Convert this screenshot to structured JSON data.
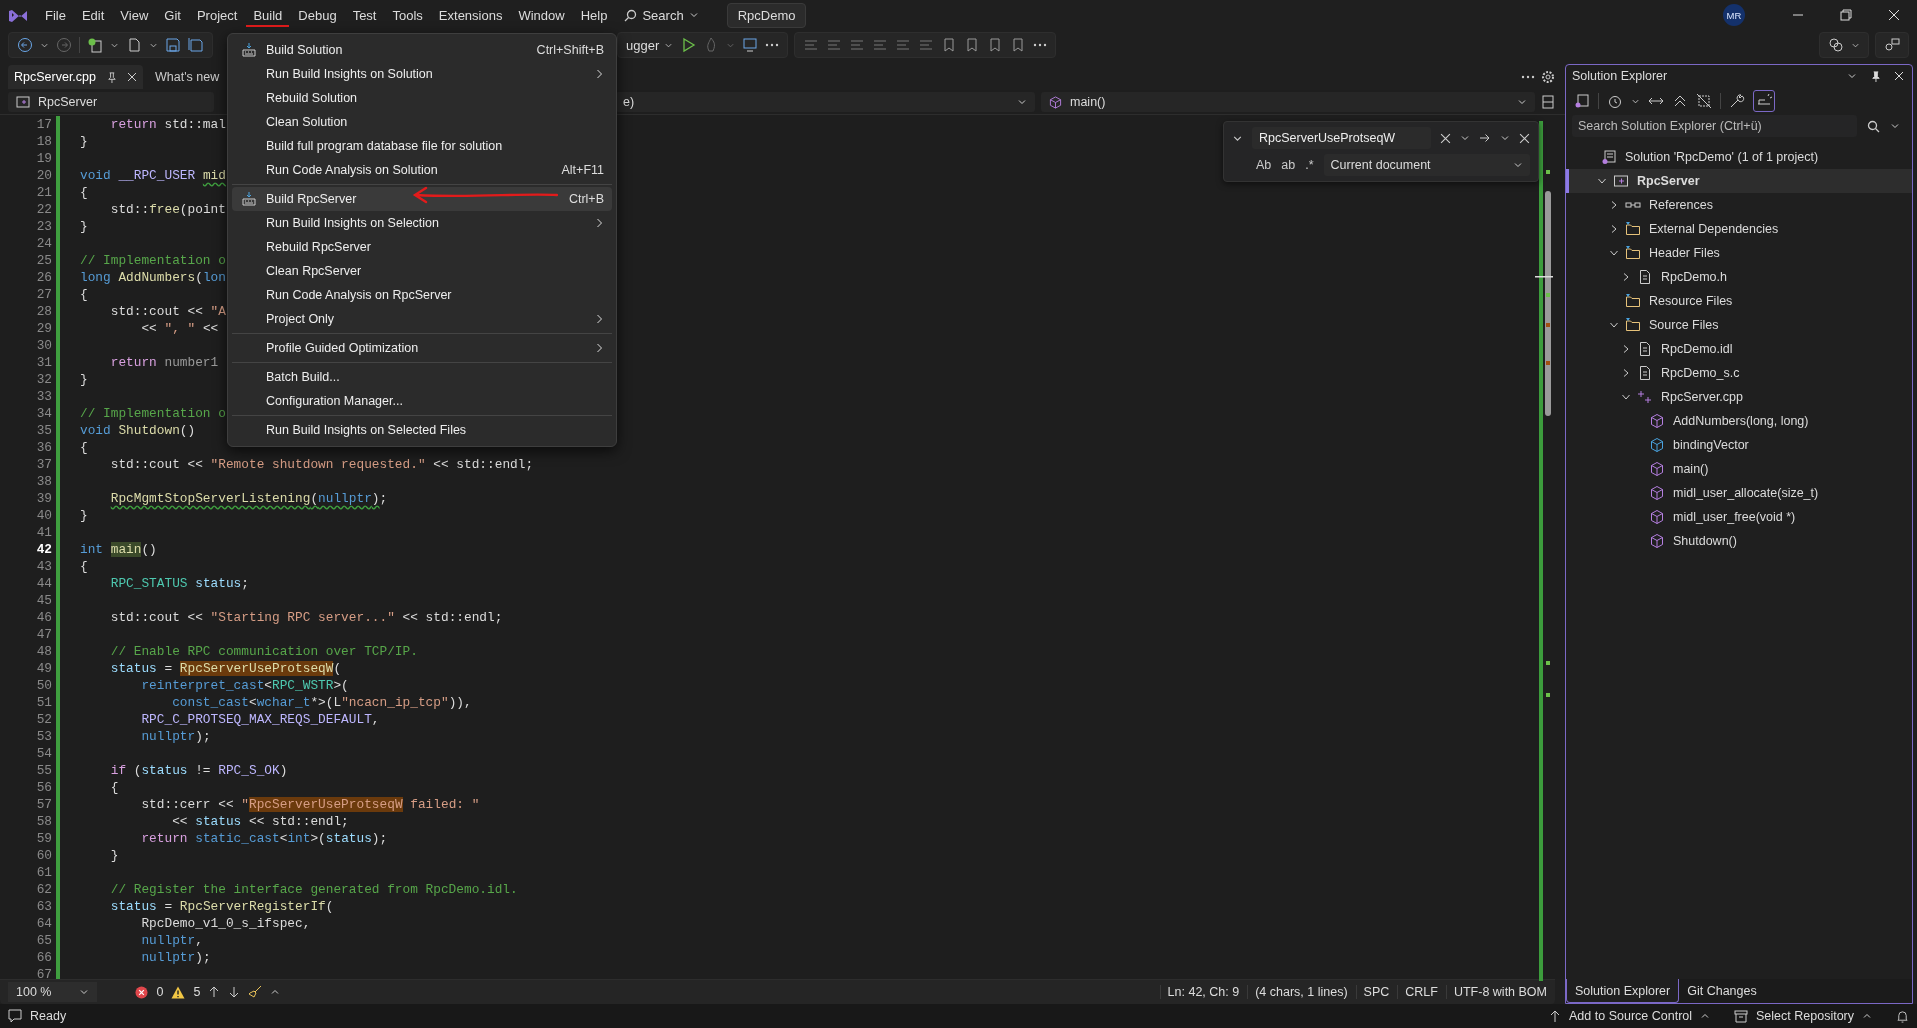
{
  "menubar": {
    "items": [
      {
        "label": "File",
        "selected": false
      },
      {
        "label": "Edit",
        "selected": false
      },
      {
        "label": "View",
        "selected": false
      },
      {
        "label": "Git",
        "selected": false
      },
      {
        "label": "Project",
        "selected": false
      },
      {
        "label": "Build",
        "selected": true
      },
      {
        "label": "Debug",
        "selected": false
      },
      {
        "label": "Test",
        "selected": false
      },
      {
        "label": "Tools",
        "selected": false
      },
      {
        "label": "Extensions",
        "selected": false
      },
      {
        "label": "Window",
        "selected": false
      },
      {
        "label": "Help",
        "selected": false
      }
    ],
    "search": "Search",
    "solution_name": "RpcDemo",
    "avatar": "MR"
  },
  "toolbar": {
    "start_text": "ugger"
  },
  "build_menu": {
    "sections": [
      {
        "items": [
          {
            "label": "Build Solution",
            "shortcut": "Ctrl+Shift+B",
            "has_icon": true,
            "submenu": false,
            "selected": false
          },
          {
            "label": "Run Build Insights on Solution",
            "has_icon": false,
            "submenu": true,
            "selected": false
          },
          {
            "label": "Rebuild Solution",
            "has_icon": false,
            "submenu": false,
            "selected": false
          },
          {
            "label": "Clean Solution",
            "has_icon": false,
            "submenu": false,
            "selected": false
          },
          {
            "label": "Build full program database file for solution",
            "has_icon": false,
            "submenu": false,
            "selected": false
          },
          {
            "label": "Run Code Analysis on Solution",
            "shortcut": "Alt+F11",
            "has_icon": false,
            "submenu": false,
            "selected": false
          }
        ]
      },
      {
        "items": [
          {
            "label": "Build RpcServer",
            "shortcut": "Ctrl+B",
            "has_icon": true,
            "submenu": false,
            "selected": true
          },
          {
            "label": "Run Build Insights on Selection",
            "has_icon": false,
            "submenu": true,
            "selected": false
          },
          {
            "label": "Rebuild RpcServer",
            "has_icon": false,
            "submenu": false,
            "selected": false
          },
          {
            "label": "Clean RpcServer",
            "has_icon": false,
            "submenu": false,
            "selected": false
          },
          {
            "label": "Run Code Analysis on RpcServer",
            "has_icon": false,
            "submenu": false,
            "selected": false
          },
          {
            "label": "Project Only",
            "has_icon": false,
            "submenu": true,
            "selected": false
          }
        ]
      },
      {
        "items": [
          {
            "label": "Profile Guided Optimization",
            "has_icon": false,
            "submenu": true,
            "selected": false
          }
        ]
      },
      {
        "items": [
          {
            "label": "Batch Build...",
            "has_icon": false,
            "submenu": false,
            "selected": false
          },
          {
            "label": "Configuration Manager...",
            "has_icon": false,
            "submenu": false,
            "selected": false
          }
        ]
      },
      {
        "items": [
          {
            "label": "Run Build Insights on Selected Files",
            "has_icon": false,
            "submenu": false,
            "selected": false
          }
        ]
      }
    ]
  },
  "editor": {
    "tabs": [
      {
        "label": "RpcServer.cpp",
        "selected": true
      },
      {
        "label": "What's new",
        "selected": false
      }
    ],
    "nav": {
      "project": "RpcServer",
      "scope": "e)",
      "member": "main()"
    },
    "find": {
      "value": "RpcServerUseProtseqW",
      "options": [
        "Ab",
        "ab",
        ".*"
      ],
      "scope": "Current document"
    },
    "lines": [
      {
        "n": "17",
        "current": false,
        "tokens": [
          {
            "text": "    return",
            "kind": "ctrl"
          },
          {
            "text": " std::mal",
            "kind": "plain"
          }
        ]
      },
      {
        "n": "18",
        "current": false,
        "tokens": [
          {
            "text": "}",
            "kind": "plain"
          }
        ]
      },
      {
        "n": "19",
        "current": false
      },
      {
        "n": "20",
        "current": false,
        "tokens": [
          {
            "text": "void",
            "kind": "kw"
          },
          {
            "text": " __RPC_USER ",
            "kind": "macro"
          },
          {
            "text": "mid",
            "kind": "fn_squiggle"
          }
        ]
      },
      {
        "n": "21",
        "current": false,
        "tokens": [
          {
            "text": "{",
            "kind": "plain"
          }
        ]
      },
      {
        "n": "22",
        "current": false,
        "tokens": [
          {
            "text": "    std::",
            "kind": "plain"
          },
          {
            "text": "free",
            "kind": "fn"
          },
          {
            "text": "(point",
            "kind": "plain"
          }
        ]
      },
      {
        "n": "23",
        "current": false,
        "tokens": [
          {
            "text": "}",
            "kind": "plain"
          }
        ]
      },
      {
        "n": "24",
        "current": false
      },
      {
        "n": "25",
        "current": false,
        "tokens": [
          {
            "text": "// Implementation o",
            "kind": "com"
          }
        ]
      },
      {
        "n": "26",
        "current": false,
        "tokens": [
          {
            "text": "long ",
            "kind": "kw"
          },
          {
            "text": "AddNumbers",
            "kind": "fn"
          },
          {
            "text": "(",
            "kind": "plain"
          },
          {
            "text": "lon",
            "kind": "kw"
          }
        ]
      },
      {
        "n": "27",
        "current": false,
        "tokens": [
          {
            "text": "{",
            "kind": "plain"
          }
        ]
      },
      {
        "n": "28",
        "current": false,
        "tokens": [
          {
            "text": "    std::cout << ",
            "kind": "plain"
          },
          {
            "text": "\"A",
            "kind": "str"
          }
        ]
      },
      {
        "n": "29",
        "current": false,
        "tokens": [
          {
            "text": "        << ",
            "kind": "plain"
          },
          {
            "text": "\", \"",
            "kind": "str"
          },
          {
            "text": " <<",
            "kind": "plain"
          }
        ]
      },
      {
        "n": "30",
        "current": false
      },
      {
        "n": "31",
        "current": false,
        "tokens": [
          {
            "text": "    return",
            "kind": "ctrl"
          },
          {
            "text": " number1",
            "kind": "param"
          }
        ]
      },
      {
        "n": "32",
        "current": false,
        "tokens": [
          {
            "text": "}",
            "kind": "plain"
          }
        ]
      },
      {
        "n": "33",
        "current": false
      },
      {
        "n": "34",
        "current": false,
        "tokens": [
          {
            "text": "// Implementation o",
            "kind": "com"
          }
        ]
      },
      {
        "n": "35",
        "current": false,
        "tokens": [
          {
            "text": "void ",
            "kind": "kw"
          },
          {
            "text": "Shutdown",
            "kind": "fn"
          },
          {
            "text": "()",
            "kind": "plain"
          }
        ]
      },
      {
        "n": "36",
        "current": false,
        "tokens": [
          {
            "text": "{",
            "kind": "plain"
          }
        ]
      },
      {
        "n": "37",
        "current": false,
        "tokens": [
          {
            "text": "    std::cout << ",
            "kind": "plain"
          },
          {
            "text": "\"Remote shutdown requested.\"",
            "kind": "str"
          },
          {
            "text": " << std::endl;",
            "kind": "plain"
          }
        ]
      },
      {
        "n": "38",
        "current": false
      },
      {
        "n": "39",
        "current": false,
        "tokens": [
          {
            "text": "    RpcMgmtStopServerListening",
            "kind": "fn_squiggle"
          },
          {
            "text": "(",
            "kind": "plain_squiggle"
          },
          {
            "text": "nullptr",
            "kind": "kw_squiggle"
          },
          {
            "text": ")",
            "kind": "plain_squiggle"
          },
          {
            "text": ";",
            "kind": "plain"
          }
        ]
      },
      {
        "n": "40",
        "current": false,
        "tokens": [
          {
            "text": "}",
            "kind": "plain"
          }
        ]
      },
      {
        "n": "41",
        "current": false
      },
      {
        "n": "42",
        "current": true,
        "tokens": [
          {
            "text": "int ",
            "kind": "kw"
          },
          {
            "text": "main",
            "kind": "fn_reference"
          },
          {
            "text": "()",
            "kind": "plain"
          }
        ]
      },
      {
        "n": "43",
        "current": false,
        "tokens": [
          {
            "text": "{",
            "kind": "plain"
          }
        ]
      },
      {
        "n": "44",
        "current": false,
        "tokens": [
          {
            "text": "    RPC_STATUS ",
            "kind": "type"
          },
          {
            "text": "status",
            "kind": "var"
          },
          {
            "text": ";",
            "kind": "plain"
          }
        ]
      },
      {
        "n": "45",
        "current": false
      },
      {
        "n": "46",
        "current": false,
        "tokens": [
          {
            "text": "    std::cout << ",
            "kind": "plain"
          },
          {
            "text": "\"Starting RPC server...\"",
            "kind": "str"
          },
          {
            "text": " << std::endl;",
            "kind": "plain"
          }
        ]
      },
      {
        "n": "47",
        "current": false
      },
      {
        "n": "48",
        "current": false,
        "tokens": [
          {
            "text": "    // Enable RPC communication over TCP/IP.",
            "kind": "com"
          }
        ]
      },
      {
        "n": "49",
        "current": false,
        "tokens": [
          {
            "text": "    status",
            "kind": "var"
          },
          {
            "text": " = ",
            "kind": "plain"
          },
          {
            "text": "RpcServerUseProtseqW",
            "kind": "fn_match"
          },
          {
            "text": "(",
            "kind": "plain"
          }
        ]
      },
      {
        "n": "50",
        "current": false,
        "tokens": [
          {
            "text": "        reinterpret_cast",
            "kind": "kw"
          },
          {
            "text": "<",
            "kind": "plain"
          },
          {
            "text": "RPC_WSTR",
            "kind": "type"
          },
          {
            "text": ">(",
            "kind": "plain"
          }
        ]
      },
      {
        "n": "51",
        "current": false,
        "tokens": [
          {
            "text": "            const_cast",
            "kind": "kw"
          },
          {
            "text": "<",
            "kind": "plain"
          },
          {
            "text": "wchar_t",
            "kind": "kw"
          },
          {
            "text": "*>(L",
            "kind": "plain"
          },
          {
            "text": "\"ncacn_ip_tcp\"",
            "kind": "str"
          },
          {
            "text": ")),",
            "kind": "plain"
          }
        ]
      },
      {
        "n": "52",
        "current": false,
        "tokens": [
          {
            "text": "        RPC_C_PROTSEQ_MAX_REQS_DEFAULT",
            "kind": "macro"
          },
          {
            "text": ",",
            "kind": "plain"
          }
        ]
      },
      {
        "n": "53",
        "current": false,
        "tokens": [
          {
            "text": "        nullptr",
            "kind": "kw"
          },
          {
            "text": ");",
            "kind": "plain"
          }
        ]
      },
      {
        "n": "54",
        "current": false
      },
      {
        "n": "55",
        "current": false,
        "tokens": [
          {
            "text": "    if",
            "kind": "ctrl"
          },
          {
            "text": " (",
            "kind": "plain"
          },
          {
            "text": "status",
            "kind": "var"
          },
          {
            "text": " != ",
            "kind": "plain"
          },
          {
            "text": "RPC_S_OK",
            "kind": "macro"
          },
          {
            "text": ")",
            "kind": "plain"
          }
        ]
      },
      {
        "n": "56",
        "current": false,
        "tokens": [
          {
            "text": "    {",
            "kind": "plain"
          }
        ]
      },
      {
        "n": "57",
        "current": false,
        "tokens": [
          {
            "text": "        std::cerr << ",
            "kind": "plain"
          },
          {
            "text": "\"",
            "kind": "str"
          },
          {
            "text": "RpcServerUseProtseqW",
            "kind": "str_match"
          },
          {
            "text": " failed: \"",
            "kind": "str"
          }
        ]
      },
      {
        "n": "58",
        "current": false,
        "tokens": [
          {
            "text": "            << ",
            "kind": "plain"
          },
          {
            "text": "status",
            "kind": "var"
          },
          {
            "text": " << std::endl;",
            "kind": "plain"
          }
        ]
      },
      {
        "n": "59",
        "current": false,
        "tokens": [
          {
            "text": "        return ",
            "kind": "ctrl"
          },
          {
            "text": "static_cast",
            "kind": "kw"
          },
          {
            "text": "<",
            "kind": "plain"
          },
          {
            "text": "int",
            "kind": "kw"
          },
          {
            "text": ">(",
            "kind": "plain"
          },
          {
            "text": "status",
            "kind": "var"
          },
          {
            "text": ");",
            "kind": "plain"
          }
        ]
      },
      {
        "n": "60",
        "current": false,
        "tokens": [
          {
            "text": "    }",
            "kind": "plain"
          }
        ]
      },
      {
        "n": "61",
        "current": false
      },
      {
        "n": "62",
        "current": false,
        "tokens": [
          {
            "text": "    // Register the interface generated from RpcDemo.idl.",
            "kind": "com"
          }
        ]
      },
      {
        "n": "63",
        "current": false,
        "tokens": [
          {
            "text": "    status",
            "kind": "var"
          },
          {
            "text": " = ",
            "kind": "plain"
          },
          {
            "text": "RpcServerRegisterIf",
            "kind": "fn"
          },
          {
            "text": "(",
            "kind": "plain"
          }
        ]
      },
      {
        "n": "64",
        "current": false,
        "tokens": [
          {
            "text": "        RpcDemo_v1_0_s_ifspec,",
            "kind": "plain"
          }
        ]
      },
      {
        "n": "65",
        "current": false,
        "tokens": [
          {
            "text": "        nullptr",
            "kind": "kw"
          },
          {
            "text": ",",
            "kind": "plain"
          }
        ]
      },
      {
        "n": "66",
        "current": false,
        "tokens": [
          {
            "text": "        nullptr",
            "kind": "kw"
          },
          {
            "text": ");",
            "kind": "plain"
          }
        ]
      },
      {
        "n": "67",
        "current": false
      }
    ],
    "status": {
      "zoom": "100 %",
      "errors": "0",
      "warnings": "5",
      "position": "Ln: 42, Ch: 9",
      "selection": "(4 chars, 1 lines)",
      "indent": "SPC",
      "line_ending": "CRLF",
      "encoding": "UTF-8 with BOM"
    }
  },
  "solution_explorer": {
    "title": "Solution Explorer",
    "search": {
      "placeholder": "Search Solution Explorer (Ctrl+ü)"
    },
    "tree": [
      {
        "label": "Solution 'RpcDemo' (1 of 1 project)",
        "kind": "solution",
        "selected": false,
        "children": [
          {
            "label": "RpcServer",
            "kind": "project",
            "expanded": true,
            "selected": true,
            "children": [
              {
                "label": "References",
                "kind": "references",
                "expanded": false,
                "selected": false
              },
              {
                "label": "External Dependencies",
                "kind": "deps",
                "expanded": false,
                "selected": false
              },
              {
                "label": "Header Files",
                "kind": "folder",
                "expanded": true,
                "selected": false,
                "children": [
                  {
                    "label": "RpcDemo.h",
                    "kind": "header",
                    "expanded": false,
                    "selected": false
                  }
                ]
              },
              {
                "label": "Resource Files",
                "kind": "folder",
                "selected": false
              },
              {
                "label": "Source Files",
                "kind": "folder",
                "expanded": true,
                "selected": false,
                "children": [
                  {
                    "label": "RpcDemo.idl",
                    "kind": "file",
                    "expanded": false,
                    "selected": false
                  },
                  {
                    "label": "RpcDemo_s.c",
                    "kind": "csource",
                    "expanded": false,
                    "selected": false
                  },
                  {
                    "label": "RpcServer.cpp",
                    "kind": "cpp",
                    "expanded": true,
                    "selected": false,
                    "children": [
                      {
                        "label": "AddNumbers(long, long)",
                        "kind": "method",
                        "selected": false
                      },
                      {
                        "label": "bindingVector",
                        "kind": "field",
                        "selected": false
                      },
                      {
                        "label": "main()",
                        "kind": "method",
                        "selected": false
                      },
                      {
                        "label": "midl_user_allocate(size_t)",
                        "kind": "method",
                        "selected": false
                      },
                      {
                        "label": "midl_user_free(void *)",
                        "kind": "method",
                        "selected": false
                      },
                      {
                        "label": "Shutdown()",
                        "kind": "method",
                        "selected": false
                      }
                    ]
                  }
                ]
              }
            ]
          }
        ]
      }
    ],
    "tabs": [
      {
        "label": "Solution Explorer",
        "selected": true
      },
      {
        "label": "Git Changes",
        "selected": false
      }
    ]
  },
  "status_bar": {
    "text": "Ready",
    "source_control": "Add to Source Control",
    "repository": "Select Repository"
  }
}
